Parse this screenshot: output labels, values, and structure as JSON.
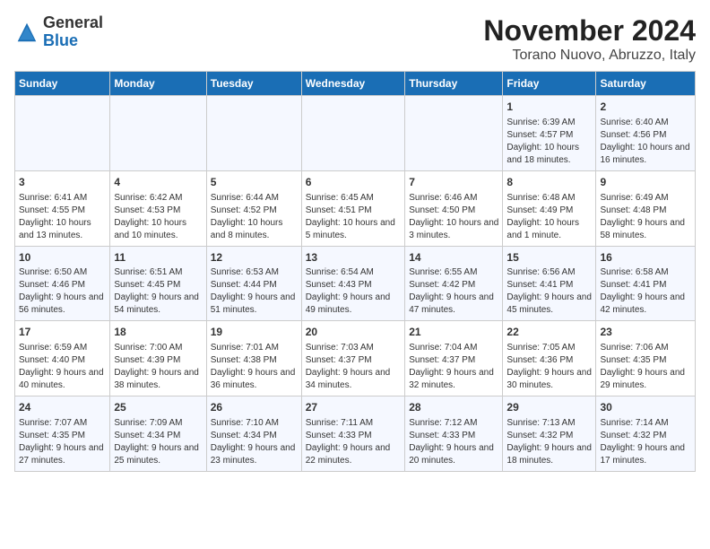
{
  "header": {
    "logo_general": "General",
    "logo_blue": "Blue",
    "title": "November 2024",
    "subtitle": "Torano Nuovo, Abruzzo, Italy"
  },
  "days_of_week": [
    "Sunday",
    "Monday",
    "Tuesday",
    "Wednesday",
    "Thursday",
    "Friday",
    "Saturday"
  ],
  "weeks": [
    [
      {
        "day": "",
        "info": ""
      },
      {
        "day": "",
        "info": ""
      },
      {
        "day": "",
        "info": ""
      },
      {
        "day": "",
        "info": ""
      },
      {
        "day": "",
        "info": ""
      },
      {
        "day": "1",
        "info": "Sunrise: 6:39 AM\nSunset: 4:57 PM\nDaylight: 10 hours and 18 minutes."
      },
      {
        "day": "2",
        "info": "Sunrise: 6:40 AM\nSunset: 4:56 PM\nDaylight: 10 hours and 16 minutes."
      }
    ],
    [
      {
        "day": "3",
        "info": "Sunrise: 6:41 AM\nSunset: 4:55 PM\nDaylight: 10 hours and 13 minutes."
      },
      {
        "day": "4",
        "info": "Sunrise: 6:42 AM\nSunset: 4:53 PM\nDaylight: 10 hours and 10 minutes."
      },
      {
        "day": "5",
        "info": "Sunrise: 6:44 AM\nSunset: 4:52 PM\nDaylight: 10 hours and 8 minutes."
      },
      {
        "day": "6",
        "info": "Sunrise: 6:45 AM\nSunset: 4:51 PM\nDaylight: 10 hours and 5 minutes."
      },
      {
        "day": "7",
        "info": "Sunrise: 6:46 AM\nSunset: 4:50 PM\nDaylight: 10 hours and 3 minutes."
      },
      {
        "day": "8",
        "info": "Sunrise: 6:48 AM\nSunset: 4:49 PM\nDaylight: 10 hours and 1 minute."
      },
      {
        "day": "9",
        "info": "Sunrise: 6:49 AM\nSunset: 4:48 PM\nDaylight: 9 hours and 58 minutes."
      }
    ],
    [
      {
        "day": "10",
        "info": "Sunrise: 6:50 AM\nSunset: 4:46 PM\nDaylight: 9 hours and 56 minutes."
      },
      {
        "day": "11",
        "info": "Sunrise: 6:51 AM\nSunset: 4:45 PM\nDaylight: 9 hours and 54 minutes."
      },
      {
        "day": "12",
        "info": "Sunrise: 6:53 AM\nSunset: 4:44 PM\nDaylight: 9 hours and 51 minutes."
      },
      {
        "day": "13",
        "info": "Sunrise: 6:54 AM\nSunset: 4:43 PM\nDaylight: 9 hours and 49 minutes."
      },
      {
        "day": "14",
        "info": "Sunrise: 6:55 AM\nSunset: 4:42 PM\nDaylight: 9 hours and 47 minutes."
      },
      {
        "day": "15",
        "info": "Sunrise: 6:56 AM\nSunset: 4:41 PM\nDaylight: 9 hours and 45 minutes."
      },
      {
        "day": "16",
        "info": "Sunrise: 6:58 AM\nSunset: 4:41 PM\nDaylight: 9 hours and 42 minutes."
      }
    ],
    [
      {
        "day": "17",
        "info": "Sunrise: 6:59 AM\nSunset: 4:40 PM\nDaylight: 9 hours and 40 minutes."
      },
      {
        "day": "18",
        "info": "Sunrise: 7:00 AM\nSunset: 4:39 PM\nDaylight: 9 hours and 38 minutes."
      },
      {
        "day": "19",
        "info": "Sunrise: 7:01 AM\nSunset: 4:38 PM\nDaylight: 9 hours and 36 minutes."
      },
      {
        "day": "20",
        "info": "Sunrise: 7:03 AM\nSunset: 4:37 PM\nDaylight: 9 hours and 34 minutes."
      },
      {
        "day": "21",
        "info": "Sunrise: 7:04 AM\nSunset: 4:37 PM\nDaylight: 9 hours and 32 minutes."
      },
      {
        "day": "22",
        "info": "Sunrise: 7:05 AM\nSunset: 4:36 PM\nDaylight: 9 hours and 30 minutes."
      },
      {
        "day": "23",
        "info": "Sunrise: 7:06 AM\nSunset: 4:35 PM\nDaylight: 9 hours and 29 minutes."
      }
    ],
    [
      {
        "day": "24",
        "info": "Sunrise: 7:07 AM\nSunset: 4:35 PM\nDaylight: 9 hours and 27 minutes."
      },
      {
        "day": "25",
        "info": "Sunrise: 7:09 AM\nSunset: 4:34 PM\nDaylight: 9 hours and 25 minutes."
      },
      {
        "day": "26",
        "info": "Sunrise: 7:10 AM\nSunset: 4:34 PM\nDaylight: 9 hours and 23 minutes."
      },
      {
        "day": "27",
        "info": "Sunrise: 7:11 AM\nSunset: 4:33 PM\nDaylight: 9 hours and 22 minutes."
      },
      {
        "day": "28",
        "info": "Sunrise: 7:12 AM\nSunset: 4:33 PM\nDaylight: 9 hours and 20 minutes."
      },
      {
        "day": "29",
        "info": "Sunrise: 7:13 AM\nSunset: 4:32 PM\nDaylight: 9 hours and 18 minutes."
      },
      {
        "day": "30",
        "info": "Sunrise: 7:14 AM\nSunset: 4:32 PM\nDaylight: 9 hours and 17 minutes."
      }
    ]
  ]
}
